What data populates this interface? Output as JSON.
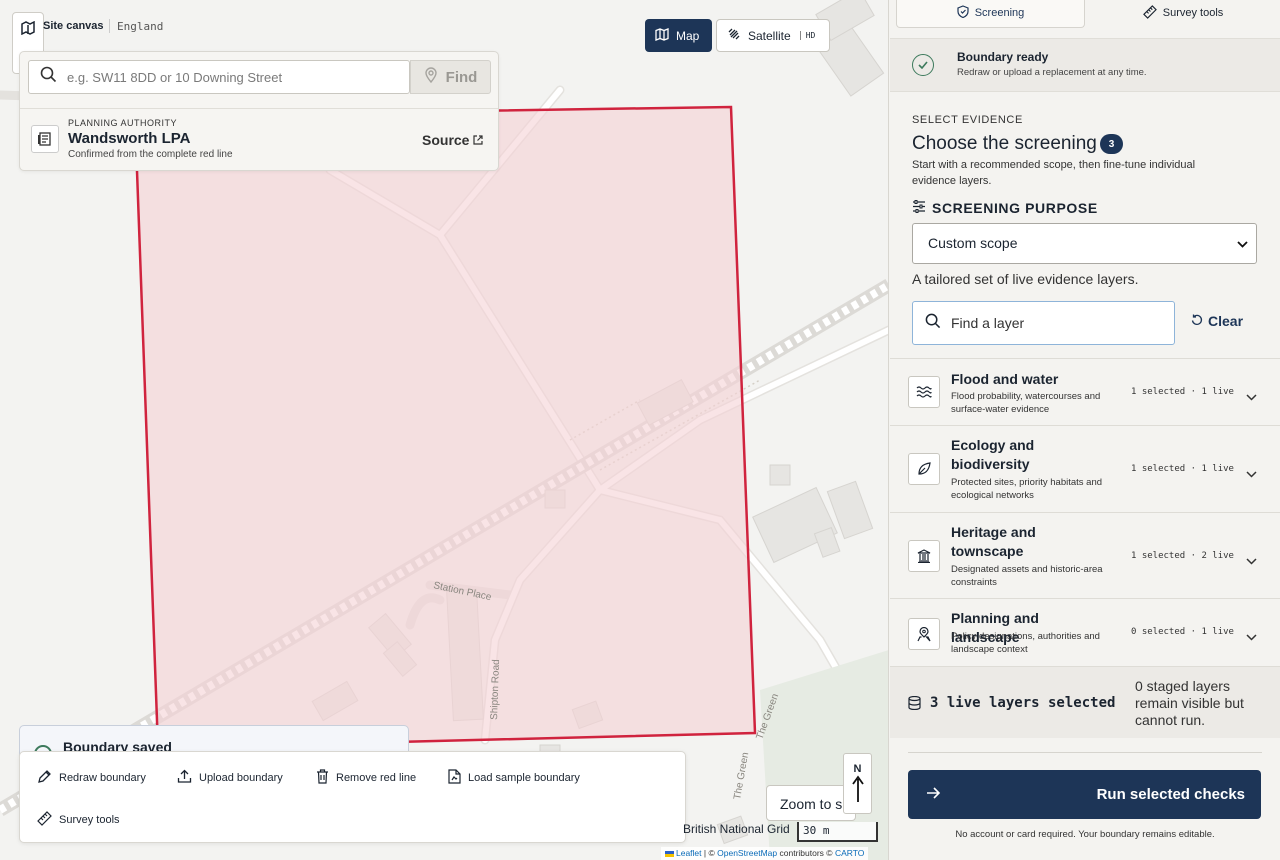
{
  "site": {
    "title": "Site canvas",
    "region": "England"
  },
  "map_mode": {
    "map_label": "Map",
    "satellite_label": "Satellite",
    "hd_label": "HD",
    "active": "map"
  },
  "search": {
    "placeholder": "e.g. SW11 8DD or 10 Downing Street",
    "find_label": "Find"
  },
  "authority": {
    "kicker": "PLANNING AUTHORITY",
    "name": "Wandsworth LPA",
    "note": "Confirmed from the complete red line",
    "source_label": "Source"
  },
  "map_labels": {
    "street_1": "Station Place",
    "street_2": "Shipton Road",
    "street_3": "The Green",
    "street_4": "The Green"
  },
  "boundary_saved": {
    "title": "Boundary saved"
  },
  "tools": {
    "redraw": "Redraw boundary",
    "upload": "Upload boundary",
    "remove": "Remove red line",
    "sample": "Load sample boundary",
    "survey": "Survey tools"
  },
  "map_controls": {
    "zoom_label": "Zoom to s",
    "north_label": "N",
    "grid_label": "British National Grid",
    "scale_label": "30 m",
    "attribution": {
      "leaflet": "Leaflet",
      "osm": "OpenStreetMap",
      "contributors": "contributors ©",
      "carto": "CARTO",
      "sep": "| ©"
    }
  },
  "sidebar": {
    "tabs": [
      {
        "label": "Screening"
      },
      {
        "label": "Survey tools"
      }
    ],
    "status": {
      "title": "Boundary ready",
      "detail": "Redraw or upload a replacement at any time."
    },
    "section_kicker": "SELECT EVIDENCE",
    "heading": "Choose the screening",
    "count": "3",
    "description": "Start with a recommended scope, then fine-tune individual evidence layers.",
    "purpose_heading": "SCREENING PURPOSE",
    "purpose_value": "Custom scope",
    "purpose_note": "A tailored set of live evidence layers.",
    "layer_search_placeholder": "Find a layer",
    "clear_label": "Clear",
    "categories": [
      {
        "title": "Flood and water",
        "sub": "Flood probability, watercourses and surface-water evidence",
        "meta": "1 selected · 1 live",
        "icon": "water-icon"
      },
      {
        "title": "Ecology and biodiversity",
        "sub": "Protected sites, priority habitats and ecological networks",
        "meta": "1 selected · 1 live",
        "icon": "leaf-icon"
      },
      {
        "title": "Heritage and townscape",
        "sub": "Designated assets and historic-area constraints",
        "meta": "1 selected · 2 live",
        "icon": "museum-icon"
      },
      {
        "title": "Planning and landscape",
        "sub": "Policy designations, authorities and landscape context",
        "meta": "0 selected · 1 live",
        "icon": "map-pin-icon"
      }
    ],
    "summary": {
      "live": "3 live layers selected",
      "staged": "0 staged layers remain visible but cannot run."
    },
    "run_label": "Run selected checks",
    "footer": "No account or card required. Your boundary remains editable."
  },
  "colors": {
    "primary": "#1d3557",
    "boundary": "#d0233e",
    "boundary_fill": "#f8dede",
    "success": "#3d7a5c"
  }
}
